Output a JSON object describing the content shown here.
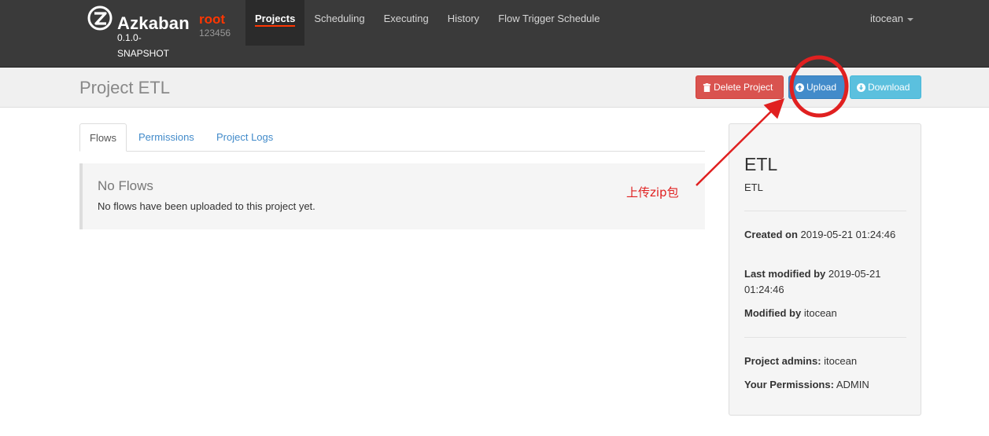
{
  "navbar": {
    "brand_name": "Azkaban",
    "version": "0.1.0-SNAPSHOT",
    "env_name": "root",
    "env_desc": "123456",
    "items": [
      {
        "label": "Projects",
        "active": true
      },
      {
        "label": "Scheduling"
      },
      {
        "label": "Executing"
      },
      {
        "label": "History"
      },
      {
        "label": "Flow Trigger Schedule"
      }
    ],
    "user": "itocean"
  },
  "header": {
    "title": "Project ETL",
    "delete_label": "Delete Project",
    "upload_label": "Upload",
    "download_label": "Download"
  },
  "tabs": [
    {
      "label": "Flows",
      "active": true
    },
    {
      "label": "Permissions"
    },
    {
      "label": "Project Logs"
    }
  ],
  "callout": {
    "title": "No Flows",
    "text": "No flows have been uploaded to this project yet."
  },
  "project_info": {
    "name": "ETL",
    "description": "ETL",
    "created_label": "Created on",
    "created_value": "2019-05-21 01:24:46",
    "modified_label": "Last modified by",
    "modified_value": "2019-05-21 01:24:46",
    "modified_by_label": "Modified by",
    "modified_by_value": "itocean",
    "admins_label": "Project admins:",
    "admins_value": "itocean",
    "permissions_label": "Your Permissions:",
    "permissions_value": "ADMIN"
  },
  "annotation": {
    "text": "上传zip包",
    "color": "#e02020"
  },
  "colors": {
    "navbar_bg": "#3a3a3a",
    "accent": "#ff3601",
    "danger": "#d9534f",
    "primary": "#428bca",
    "info": "#5bc0de"
  }
}
